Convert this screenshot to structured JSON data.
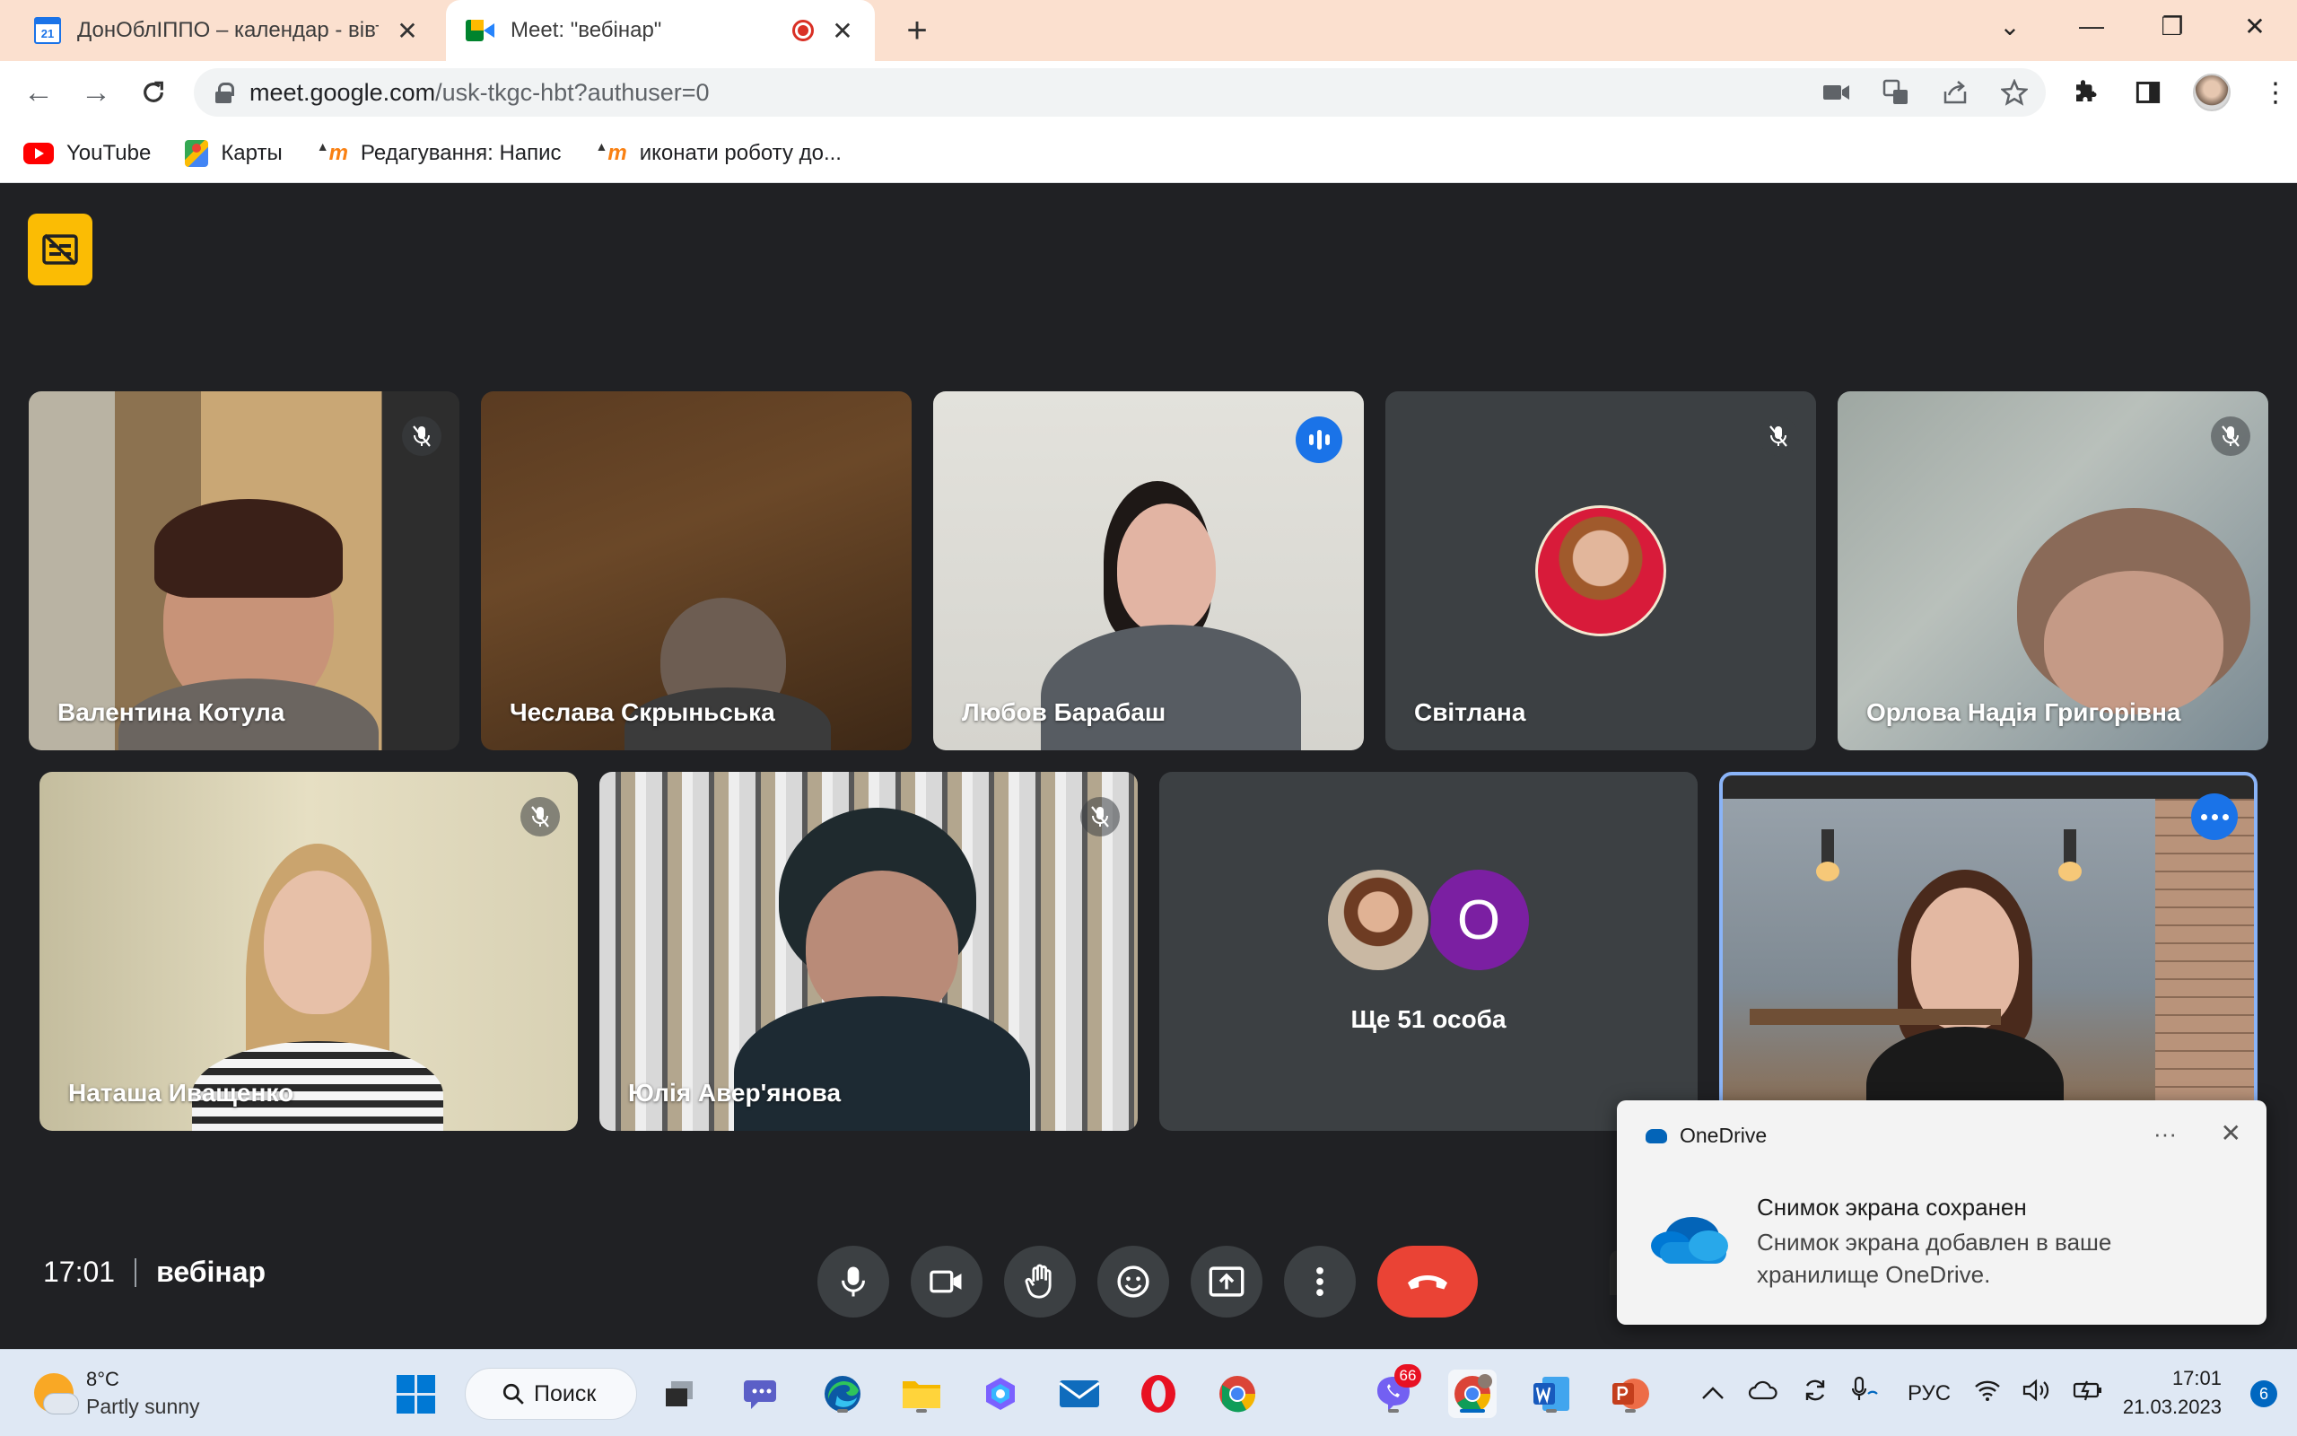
{
  "tabs": [
    {
      "title": "ДонОблІППО – календар - вівто",
      "close": "✕"
    },
    {
      "title": "Meet: \"вебінар\"",
      "close": "✕"
    }
  ],
  "new_tab": "+",
  "window_controls": {
    "list": "⌄",
    "minimize": "—",
    "restore": "❐",
    "close": "✕"
  },
  "address_bar": {
    "host": "meet.google.com",
    "path": "/usk-tkgc-hbt?authuser=0"
  },
  "bookmarks": [
    {
      "label": "YouTube"
    },
    {
      "label": "Карты"
    },
    {
      "label": "Редагування: Напис"
    },
    {
      "label": "иконати роботу до..."
    }
  ],
  "participants": [
    {
      "name": "Валентина Котула",
      "state": "muted"
    },
    {
      "name": "Чеслава Скрыньська",
      "state": ""
    },
    {
      "name": "Любов Барабаш",
      "state": "speaking"
    },
    {
      "name": "Світлана",
      "state": "muted"
    },
    {
      "name": "Орлова Надія Григорівна",
      "state": "muted"
    },
    {
      "name": "Наташа Иващенко",
      "state": "muted"
    },
    {
      "name": "Юлія Авер'янова",
      "state": "muted"
    }
  ],
  "others_tile": {
    "avatar_letter": "О",
    "label": "Ще 51 особа"
  },
  "meeting": {
    "time": "17:01",
    "name": "вебінар"
  },
  "toast": {
    "app": "OneDrive",
    "more": "···",
    "close": "✕",
    "title": "Снимок экрана сохранен",
    "body": "Снимок экрана добавлен в ваше хранилище OneDrive."
  },
  "taskbar": {
    "weather_temp": "8°C",
    "weather_desc": "Partly sunny",
    "search_label": "Поиск",
    "viber_badge": "66",
    "language": "РУС",
    "time": "17:01",
    "date": "21.03.2023",
    "notifications": "6"
  },
  "colors": {
    "meet_bg": "#202124",
    "tile_bg": "#3c4043",
    "accent_blue": "#1a73e8",
    "end_call_red": "#ea4335",
    "caption_yellow": "#fbbc04",
    "tab_strip": "#fbe0cf"
  }
}
